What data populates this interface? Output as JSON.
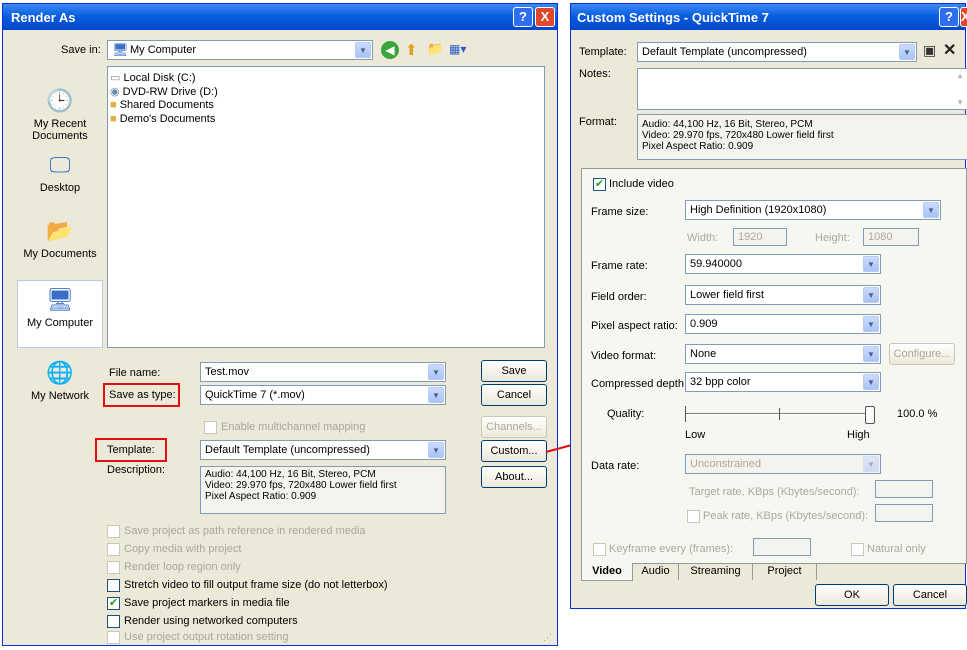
{
  "render_as": {
    "title": "Render As",
    "title_help": "?",
    "title_close": "X",
    "save_in_label": "Save in:",
    "save_in_value": "My Computer",
    "places": [
      {
        "label": "My Recent Documents",
        "icon": "recent-documents-icon"
      },
      {
        "label": "Desktop",
        "icon": "desktop-icon"
      },
      {
        "label": "My Documents",
        "icon": "my-documents-icon"
      },
      {
        "label": "My Computer",
        "icon": "my-computer-icon"
      },
      {
        "label": "My Network",
        "icon": "my-network-icon"
      }
    ],
    "files": [
      {
        "name": "Local Disk (C:)",
        "icon": "disk-icon"
      },
      {
        "name": "DVD-RW Drive (D:)",
        "icon": "dvd-icon"
      },
      {
        "name": "Shared Documents",
        "icon": "folder-icon"
      },
      {
        "name": "Demo's Documents",
        "icon": "folder-icon"
      }
    ],
    "file_name_label": "File name:",
    "file_name_value": "Test.mov",
    "save_as_type_label": "Save as type:",
    "save_as_type_value": "QuickTime 7 (*.mov)",
    "multichannel_label": "Enable multichannel mapping",
    "template_label": "Template:",
    "template_value": "Default Template (uncompressed)",
    "description_label": "Description:",
    "description_lines": [
      "Audio: 44,100 Hz, 16 Bit, Stereo, PCM",
      "Video: 29.970 fps, 720x480 Lower field first",
      "Pixel Aspect Ratio: 0.909"
    ],
    "buttons": {
      "save": "Save",
      "cancel": "Cancel",
      "channels": "Channels...",
      "custom": "Custom...",
      "about": "About..."
    },
    "options": [
      {
        "label": "Save project as path reference in rendered media",
        "checked": false,
        "enabled": false
      },
      {
        "label": "Copy media with project",
        "checked": false,
        "enabled": false
      },
      {
        "label": "Render loop region only",
        "checked": false,
        "enabled": false
      },
      {
        "label": "Stretch video to fill output frame size (do not letterbox)",
        "checked": false,
        "enabled": true
      },
      {
        "label": "Save project markers in media file",
        "checked": true,
        "enabled": true
      },
      {
        "label": "Render using networked computers",
        "checked": false,
        "enabled": true
      },
      {
        "label": "Use project output rotation setting",
        "checked": false,
        "enabled": false
      }
    ]
  },
  "custom": {
    "title": "Custom Settings - QuickTime 7",
    "title_help": "?",
    "title_close": "X",
    "template_label": "Template:",
    "template_value": "Default Template (uncompressed)",
    "notes_label": "Notes:",
    "format_label": "Format:",
    "format_lines": [
      "Audio: 44,100 Hz, 16 Bit, Stereo, PCM",
      "Video: 29.970 fps, 720x480 Lower field first",
      "Pixel Aspect Ratio: 0.909"
    ],
    "include_video_label": "Include video",
    "frame_size_label": "Frame size:",
    "frame_size_value": "High Definition (1920x1080)",
    "width_label": "Width:",
    "width_value": "1920",
    "height_label": "Height:",
    "height_value": "1080",
    "frame_rate_label": "Frame rate:",
    "frame_rate_value": "59.940000",
    "field_order_label": "Field order:",
    "field_order_value": "Lower field first",
    "par_label": "Pixel aspect ratio:",
    "par_value": "0.909",
    "video_format_label": "Video format:",
    "video_format_value": "None",
    "configure_label": "Configure...",
    "depth_label": "Compressed depth:",
    "depth_value": "32 bpp color",
    "quality_label": "Quality:",
    "quality_value": "100.0 %",
    "quality_fraction": 1.0,
    "quality_low": "Low",
    "quality_high": "High",
    "data_rate_label": "Data rate:",
    "data_rate_value": "Unconstrained",
    "target_rate_label": "Target rate, KBps (Kbytes/second):",
    "peak_rate_label": "Peak rate, KBps (Kbytes/second):",
    "keyframe_label": "Keyframe every (frames):",
    "natural_only_label": "Natural only",
    "tabs": [
      "Video",
      "Audio",
      "Streaming",
      "Project"
    ],
    "ok_label": "OK",
    "cancel_label": "Cancel"
  },
  "colors": {
    "annotation_red": "#e01010",
    "titlebar_blue": "#0a5fe0"
  }
}
